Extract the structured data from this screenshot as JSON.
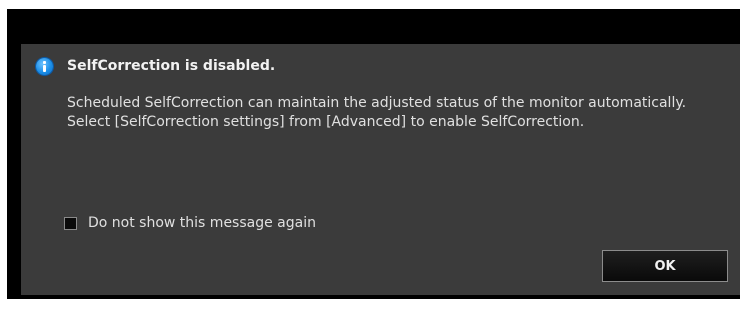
{
  "dialog": {
    "title": "SelfCorrection is disabled.",
    "message_lines": [
      "Scheduled SelfCorrection can maintain the adjusted status of the monitor automatically.",
      "Select [SelfCorrection settings] from [Advanced] to enable SelfCorrection."
    ],
    "icon": "info-icon",
    "checkbox": {
      "label": "Do not show this message again",
      "checked": false
    },
    "ok_label": "OK"
  },
  "colors": {
    "frame": "#000000",
    "body": "#3b3b3b",
    "text": "#e0e0e0",
    "info_icon": "#1a8ee8"
  }
}
